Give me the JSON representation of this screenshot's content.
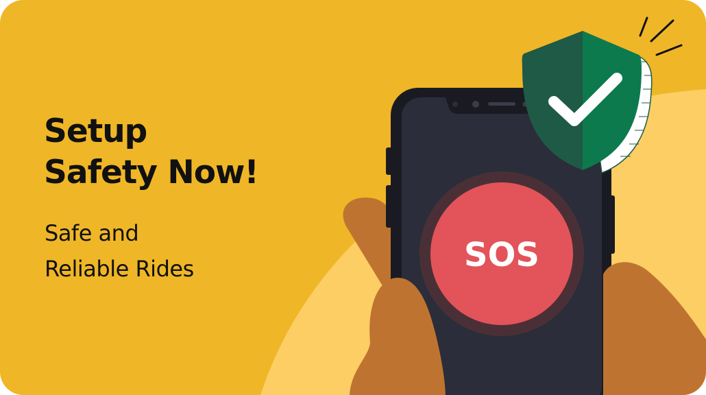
{
  "banner": {
    "headline_line1": "Setup",
    "headline_line2": "Safety Now!",
    "subline_line1": "Safe and",
    "subline_line2": "Reliable Rides",
    "sos_label": "SOS"
  },
  "colors": {
    "background": "#EFB627",
    "background_curve": "#FCCE64",
    "phone_frame": "#1A1B22",
    "phone_screen": "#2B2D3A",
    "sos_button": "#E2545A",
    "hand": "#BE7430",
    "shield_dark": "#1E5A45",
    "shield_light": "#0D7A4E",
    "text": "#111111"
  },
  "icons": [
    "shield-check-icon",
    "sparkle-lines-icon",
    "sos-button-icon"
  ]
}
